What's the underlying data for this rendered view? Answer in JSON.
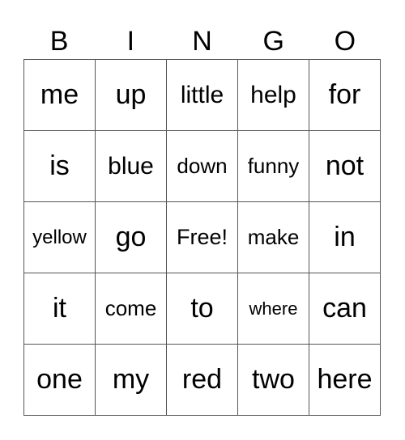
{
  "header": {
    "letters": [
      "B",
      "I",
      "N",
      "G",
      "O"
    ]
  },
  "card": {
    "rows": [
      [
        "me",
        "up",
        "little",
        "help",
        "for"
      ],
      [
        "is",
        "blue",
        "down",
        "funny",
        "not"
      ],
      [
        "yellow",
        "go",
        "Free!",
        "make",
        "in"
      ],
      [
        "it",
        "come",
        "to",
        "where",
        "can"
      ],
      [
        "one",
        "my",
        "red",
        "two",
        "here"
      ]
    ]
  }
}
